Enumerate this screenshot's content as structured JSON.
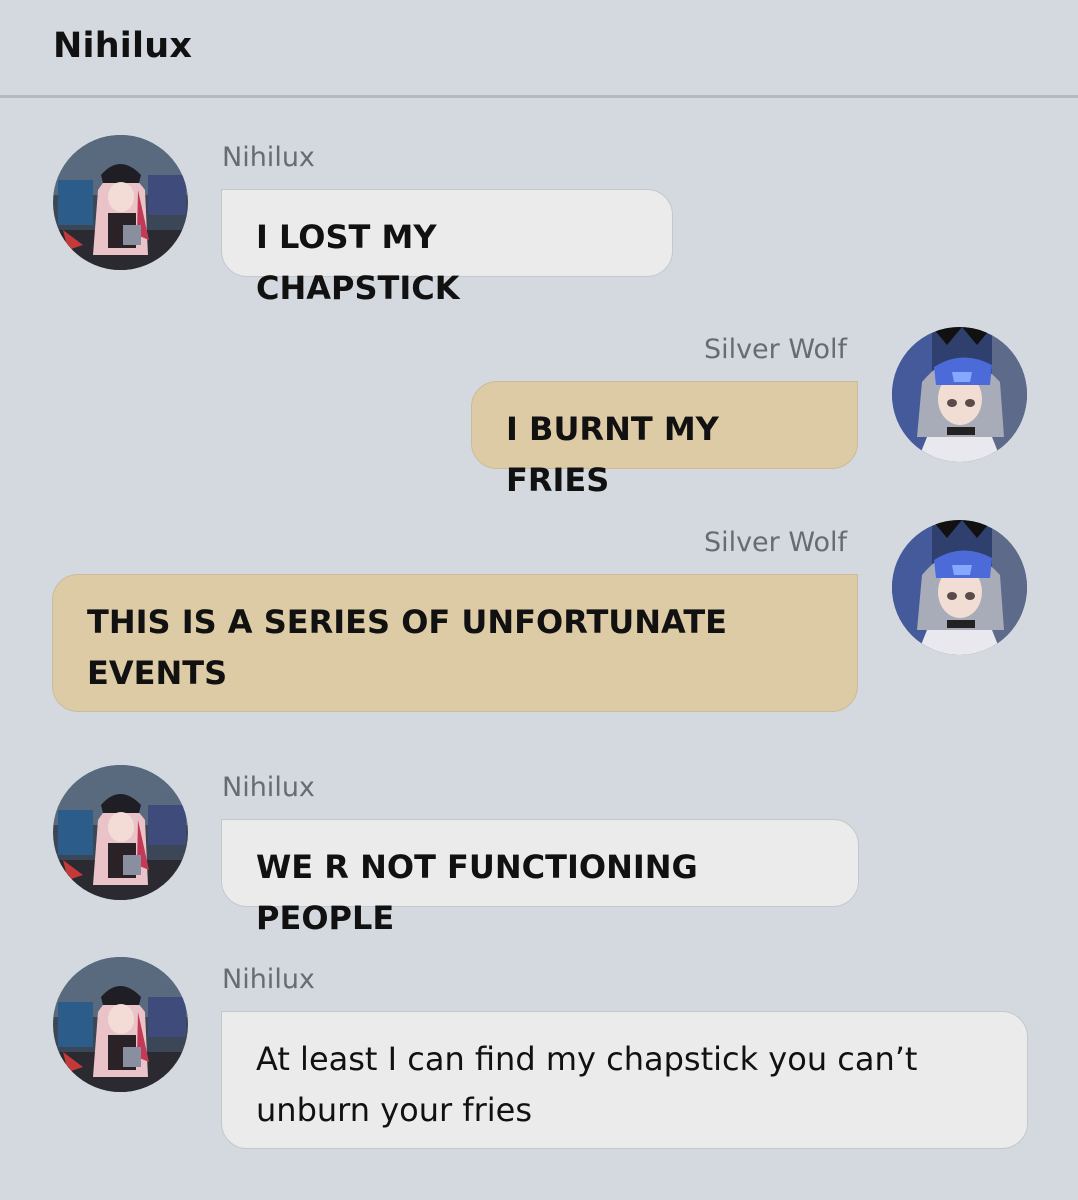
{
  "header": {
    "title": "Nihilux"
  },
  "messages": [
    {
      "sender": "Nihilux",
      "text": "I LOST MY CHAPSTICK",
      "side": "left",
      "avatar": "nihilux-avatar-icon"
    },
    {
      "sender": "Silver Wolf",
      "text": "I BURNT MY FRIES",
      "side": "right",
      "avatar": "silver-wolf-avatar-icon"
    },
    {
      "sender": "Silver Wolf",
      "text": "THIS IS A SERIES OF UNFORTUNATE EVENTS",
      "side": "right",
      "avatar": "silver-wolf-avatar-icon"
    },
    {
      "sender": "Nihilux",
      "text": "WE R NOT FUNCTIONING PEOPLE",
      "side": "left",
      "avatar": "nihilux-avatar-icon"
    },
    {
      "sender": "Nihilux",
      "text": "At least I can find my chapstick you can’t unburn your fries",
      "side": "left",
      "avatar": "nihilux-avatar-icon"
    }
  ],
  "colors": {
    "background": "#d3d9de",
    "left_bubble": "#ebebeb",
    "right_bubble": "#ddcba6",
    "sender_name": "#666c72"
  }
}
